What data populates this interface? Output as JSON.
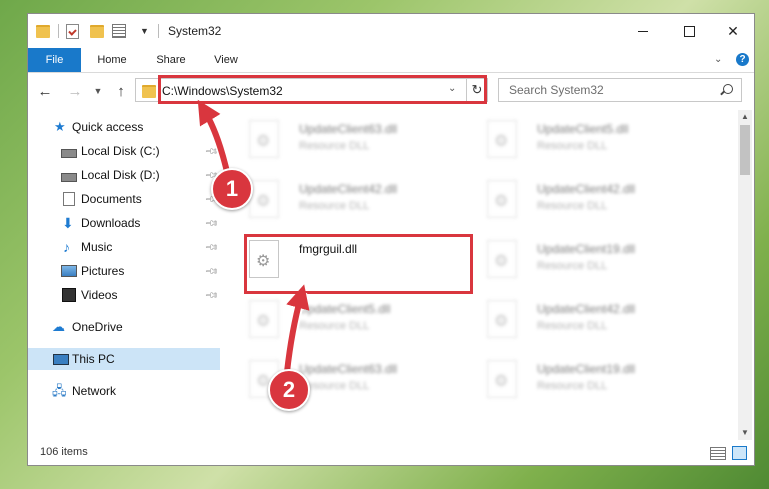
{
  "window": {
    "title": "System32",
    "controls": {
      "minimize": "—",
      "maximize": "☐",
      "close": "✕"
    }
  },
  "ribbon": {
    "tabs": [
      "File",
      "Home",
      "Share",
      "View"
    ],
    "help": "?"
  },
  "address": {
    "path": "C:\\Windows\\System32",
    "search_placeholder": "Search System32"
  },
  "sidebar": {
    "items": [
      {
        "label": "Quick access",
        "icon": "star-icon"
      },
      {
        "label": "Local Disk (C:)",
        "icon": "disk-icon",
        "pinned": true
      },
      {
        "label": "Local Disk (D:)",
        "icon": "disk-icon",
        "pinned": true
      },
      {
        "label": "Documents",
        "icon": "documents-icon",
        "pinned": true
      },
      {
        "label": "Downloads",
        "icon": "download-icon",
        "pinned": true
      },
      {
        "label": "Music",
        "icon": "music-icon",
        "pinned": true
      },
      {
        "label": "Pictures",
        "icon": "pictures-icon",
        "pinned": true
      },
      {
        "label": "Videos",
        "icon": "videos-icon",
        "pinned": true
      },
      {
        "label": "OneDrive",
        "icon": "cloud-icon"
      },
      {
        "label": "This PC",
        "icon": "computer-icon",
        "selected": true
      },
      {
        "label": "Network",
        "icon": "network-icon"
      }
    ]
  },
  "files": [
    {
      "name": "UpdateClient63.dll",
      "type": "Resource DLL",
      "blurred": true
    },
    {
      "name": "UpdateClient5.dll",
      "type": "Resource DLL",
      "blurred": true
    },
    {
      "name": "UpdateClient42.dll",
      "type": "Resource DLL",
      "blurred": true
    },
    {
      "name": "UpdateClient42.dll",
      "type": "Resource DLL",
      "blurred": true
    },
    {
      "name": "fmgrguil.dll",
      "type": "",
      "blurred": false
    },
    {
      "name": "UpdateClient19.dll",
      "type": "Resource DLL",
      "blurred": true
    },
    {
      "name": "UpdateClient5.dll",
      "type": "Resource DLL",
      "blurred": true
    },
    {
      "name": "UpdateClient42.dll",
      "type": "Resource DLL",
      "blurred": true
    },
    {
      "name": "UpdateClient63.dll",
      "type": "Resource DLL",
      "blurred": true
    },
    {
      "name": "UpdateClient19.dll",
      "type": "Resource DLL",
      "blurred": true
    }
  ],
  "status": {
    "items": "106 items"
  },
  "annotations": {
    "step1": "1",
    "step2": "2",
    "color": "#d9363e"
  },
  "colors": {
    "accent": "#1979ca",
    "selected": "#cce4f7"
  }
}
